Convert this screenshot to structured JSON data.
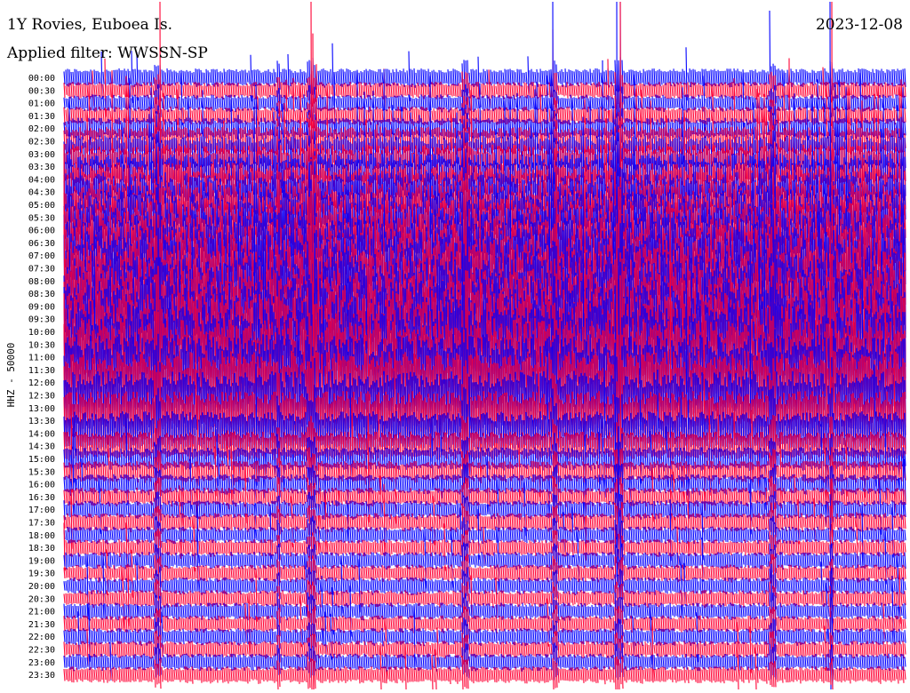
{
  "header": {
    "station": "1Y Rovies, Euboea Is.",
    "date": "2023-12-08",
    "filter": "Applied filter: WWSSN-SP"
  },
  "chart_data": {
    "type": "line",
    "title": "1Y Rovies, Euboea Is.",
    "ylabel": "HHZ - 50000",
    "colors": [
      "#0000ff",
      "#ff0033"
    ],
    "rows": [
      "00:00",
      "00:30",
      "01:00",
      "01:30",
      "02:00",
      "02:30",
      "03:00",
      "03:30",
      "04:00",
      "04:30",
      "05:00",
      "05:30",
      "06:00",
      "06:30",
      "07:00",
      "07:30",
      "08:00",
      "08:30",
      "09:00",
      "09:30",
      "10:00",
      "10:30",
      "11:00",
      "11:30",
      "12:00",
      "12:30",
      "13:00",
      "13:30",
      "14:00",
      "14:30",
      "15:00",
      "15:30",
      "16:00",
      "16:30",
      "17:00",
      "17:30",
      "18:00",
      "18:30",
      "19:00",
      "19:30",
      "20:00",
      "20:30",
      "21:00",
      "21:30",
      "22:00",
      "22:30",
      "23:00",
      "23:30"
    ],
    "relative_amplitude": [
      1.3,
      1.2,
      1.2,
      1.3,
      1.5,
      2.0,
      2.5,
      3.0,
      3.5,
      4.0,
      4.5,
      5.0,
      5.5,
      6.0,
      6.5,
      7.0,
      7.5,
      7.5,
      7.5,
      7.5,
      7.5,
      7.5,
      7.5,
      7.0,
      6.5,
      6.0,
      5.0,
      4.0,
      3.0,
      2.0,
      1.6,
      1.5,
      1.4,
      1.3,
      1.3,
      1.3,
      1.2,
      1.2,
      1.2,
      1.2,
      1.2,
      1.2,
      1.2,
      1.2,
      1.2,
      1.2,
      1.2,
      1.2
    ]
  }
}
